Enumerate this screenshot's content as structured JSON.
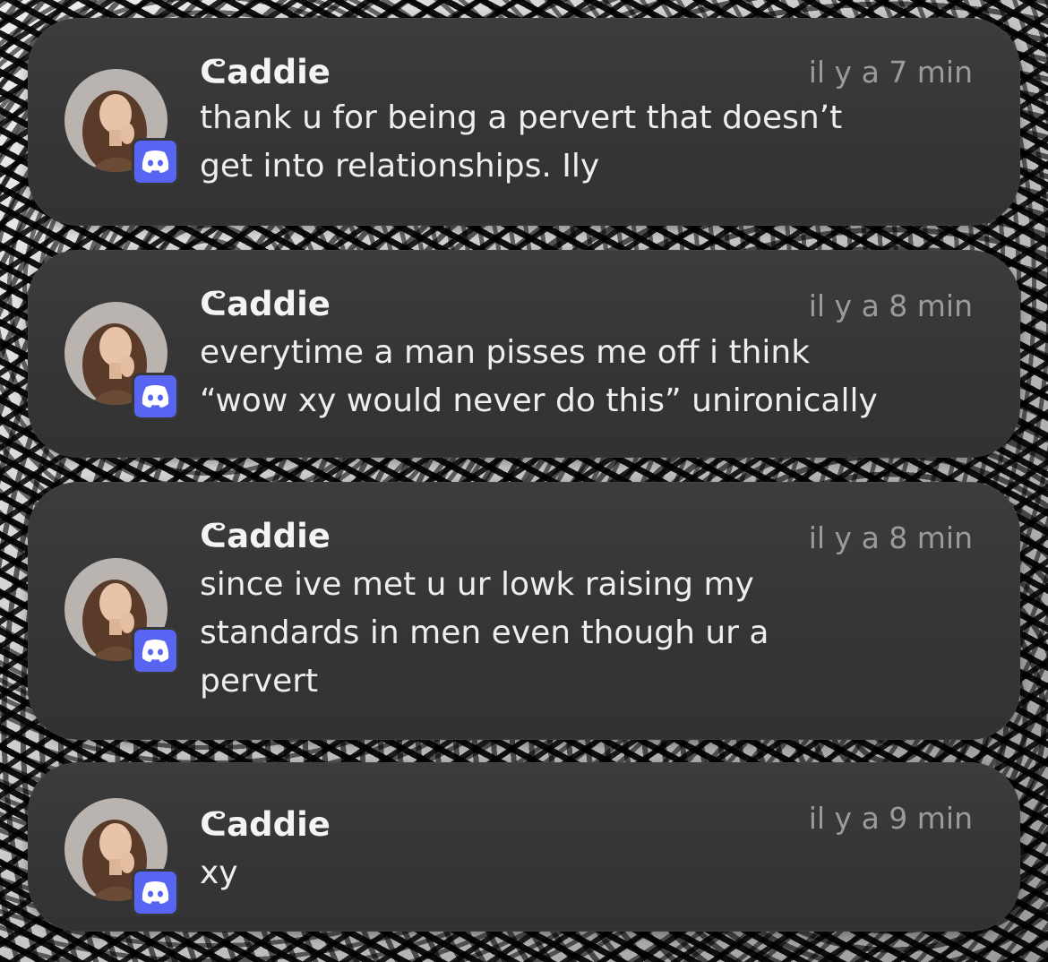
{
  "wallpaper": {
    "description_icon": "manga-lockscreen-wallpaper"
  },
  "colors": {
    "card_background": "#363637",
    "sender_text": "#f4f4f4",
    "time_text": "#9b9b9d",
    "message_text": "#eeeeee",
    "discord_badge": "#5865f2"
  },
  "notifications": [
    {
      "sender": "ᕦaddie",
      "time": "il y a 7 min",
      "message": "thank u for being a pervert that doesn’t\nget into relationships. Ily",
      "app_icon": "discord-icon"
    },
    {
      "sender": "ᕦaddie",
      "time": "il y a 8 min",
      "message": "everytime a man pisses me off i think\n“wow xy would never do this” unironically",
      "app_icon": "discord-icon"
    },
    {
      "sender": "ᕦaddie",
      "time": "il y a 8 min",
      "message": "since ive met u ur lowk raising my\nstandards in men even though ur a\npervert",
      "app_icon": "discord-icon"
    },
    {
      "sender": "ᕦaddie",
      "time": "il y a 9 min",
      "message": "xy",
      "app_icon": "discord-icon"
    }
  ]
}
